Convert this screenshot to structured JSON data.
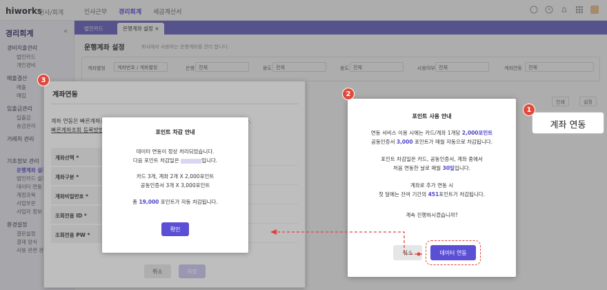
{
  "app": {
    "logo": "hiworks",
    "logo_sub": "인사/회계",
    "nav": [
      "인사근무",
      "경리회계",
      "세금계산서"
    ],
    "active_nav": "경리회계"
  },
  "sidebar": {
    "title": "경리회계",
    "groups": [
      {
        "label": "경비지출관리",
        "items": [
          "법인카드",
          "개인경비"
        ]
      },
      {
        "label": "매출결산",
        "items": [
          "매출",
          "매입"
        ]
      },
      {
        "label": "입출금관리",
        "items": [
          "입출금",
          "송금관리"
        ]
      },
      {
        "label": "거래처 관리",
        "items": []
      },
      {
        "label": "기초정보 관리",
        "items": [
          "운행계좌 설정",
          "법인카드 설정",
          "데이터 연동",
          "계정과목",
          "사업부문",
          "사업자 정보"
        ]
      },
      {
        "label": "환경설정",
        "items": [
          "결문설정",
          "결재 양식",
          "사용 관련 관리"
        ]
      }
    ]
  },
  "tabs": [
    "법인카드",
    "은행계좌 설정"
  ],
  "content": {
    "title": "운행계좌 설정",
    "desc": "회사에서 사용하는 운행계좌를 관리 합니다.",
    "filters": [
      {
        "label": "계좌별칭",
        "value": "계좌번호 / 계좌별칭"
      },
      {
        "label": "은행",
        "value": "전체"
      },
      {
        "label": "용도",
        "value": "전체"
      },
      {
        "label": "용도",
        "value": "전체"
      },
      {
        "label": "사용여부",
        "value": "전체"
      },
      {
        "label": "계좌연동",
        "value": "전체"
      }
    ],
    "toolbar": [
      "인쇄",
      "설정"
    ]
  },
  "modal3": {
    "badge": "3",
    "title": "계좌연동",
    "desc1": "계좌 연동은 빠른계좌조",
    "desc_tail": "다.",
    "desc2": "빠른계좌조회 등록방법",
    "rows": [
      "계좌선택 *",
      "계좌구분 *",
      "계좌비밀번호 *",
      "조회전용 ID *",
      "조회전용 PW *"
    ],
    "cancel": "취소",
    "save": "저장"
  },
  "alert": {
    "title": "포인트 차감 안내",
    "line1": "데이터 연동이 정상 처리되었습니다.",
    "line2_pre": "다음 포인트 차감일은",
    "line2_post": "입니다.",
    "line3": "카드 3개, 계좌 2개 X 2,000포인트",
    "line4": "공동인증서 3개 X 3,000포인트",
    "line5_pre": "총",
    "line5_amount": "19,000",
    "line5_post": "포인트가 자동 차감됩니다.",
    "ok": "확인"
  },
  "modal2": {
    "badge": "2",
    "title": "포인트 사용 안내",
    "l1_pre": "연동 서비스 이용 시에는 카드/계좌 1개당",
    "l1_hl": "2,000포인트",
    "l2_pre": "공동인증서",
    "l2_hl": "3,000",
    "l2_post": "포인트가 매월 자동으로 차감됩니다.",
    "l3": "포인트 차감일은 카드, 공동인증서, 계좌 중에서",
    "l4_pre": "처음 연동한 날로 매월",
    "l4_hl": "30일",
    "l4_post": "입니다.",
    "l5": "계좌로 추가 연동 시",
    "l6_pre": "첫 달에는 잔여 기간의",
    "l6_hl": "451",
    "l6_post": "포인트가 차감됩니다.",
    "l7": "계속 진행하시겠습니까?",
    "cancel": "취소",
    "confirm": "데이터 연동"
  },
  "callout": {
    "badge": "1",
    "label": "계좌 연동"
  },
  "colors": {
    "accent": "#5b4fd6",
    "badge": "#e04a3c",
    "dash": "#e0413b"
  }
}
